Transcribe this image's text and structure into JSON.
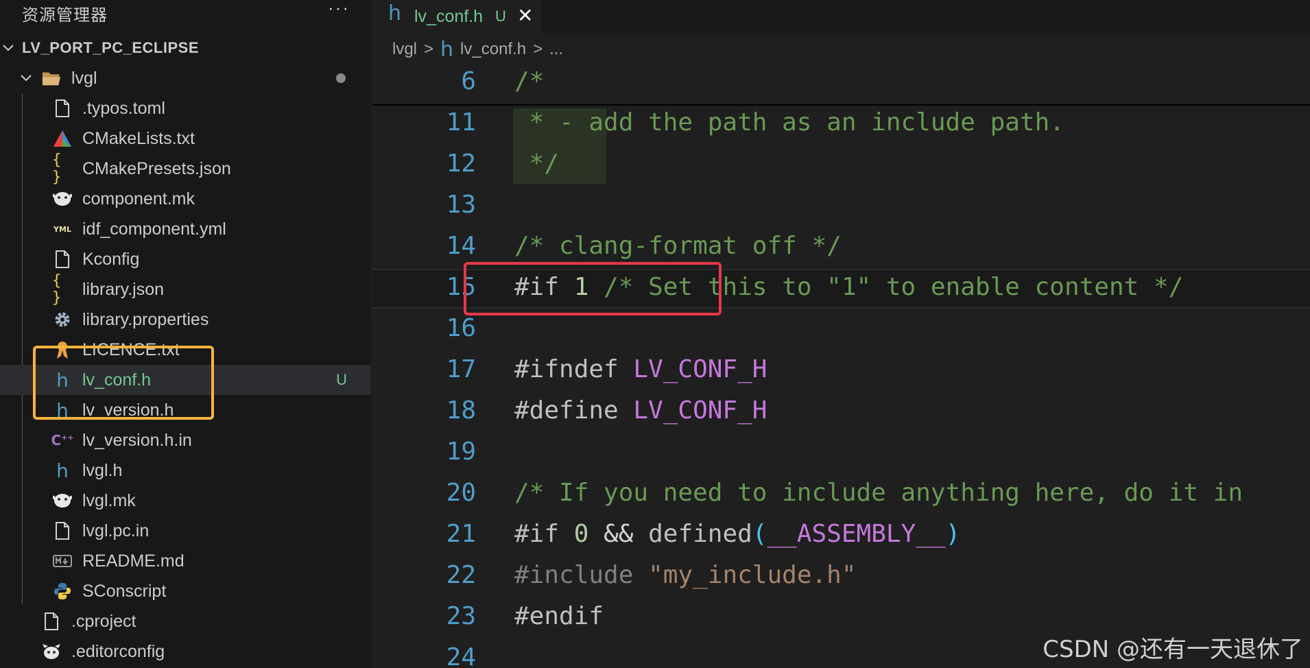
{
  "explorer": {
    "title": "资源管理器",
    "more": "···",
    "project": "LV_PORT_PC_ECLIPSE",
    "folder": "lvgl",
    "files": [
      {
        "name": ".typos.toml",
        "icon": "file-icon"
      },
      {
        "name": "CMakeLists.txt",
        "icon": "cmake-icon"
      },
      {
        "name": "CMakePresets.json",
        "icon": "json-icon"
      },
      {
        "name": "component.mk",
        "icon": "makefile-icon"
      },
      {
        "name": "idf_component.yml",
        "icon": "yaml-icon"
      },
      {
        "name": "Kconfig",
        "icon": "file-icon"
      },
      {
        "name": "library.json",
        "icon": "json-icon"
      },
      {
        "name": "library.properties",
        "icon": "gear-icon"
      },
      {
        "name": "LICENCE.txt",
        "icon": "license-icon"
      },
      {
        "name": "lv_conf.h",
        "icon": "header-h-icon",
        "badge": "U"
      },
      {
        "name": "lv_version.h",
        "icon": "header-h-icon"
      },
      {
        "name": "lv_version.h.in",
        "icon": "cpp-icon"
      },
      {
        "name": "lvgl.h",
        "icon": "header-h-icon"
      },
      {
        "name": "lvgl.mk",
        "icon": "makefile-icon"
      },
      {
        "name": "lvgl.pc.in",
        "icon": "file-icon"
      },
      {
        "name": "README.md",
        "icon": "markdown-icon"
      },
      {
        "name": "SConscript",
        "icon": "python-icon"
      }
    ],
    "root_files": [
      {
        "name": ".cproject",
        "icon": "file-icon"
      },
      {
        "name": ".editorconfig",
        "icon": "editorconfig-icon"
      }
    ]
  },
  "tab": {
    "icon_glyph": "h",
    "label": "lv_conf.h",
    "status": "U",
    "close": "✕"
  },
  "breadcrumb": {
    "folder": "lvgl",
    "sep": ">",
    "icon_glyph": "h",
    "file": "lv_conf.h",
    "more": "..."
  },
  "editor": {
    "lines": [
      {
        "n": "6",
        "text": "/*"
      },
      {
        "n": "11",
        "text": " * - add the path as an include path."
      },
      {
        "n": "12",
        "text": " */"
      },
      {
        "n": "13",
        "text": ""
      },
      {
        "n": "14",
        "text": "/* clang-format off */"
      },
      {
        "n": "15",
        "a": "#if ",
        "b": "1",
        "c": " /* Set this to \"1\" to enable content */"
      },
      {
        "n": "16",
        "text": ""
      },
      {
        "n": "17",
        "a": "#ifndef ",
        "b": "LV_CONF_H"
      },
      {
        "n": "18",
        "a": "#define ",
        "b": "LV_CONF_H"
      },
      {
        "n": "19",
        "text": ""
      },
      {
        "n": "20",
        "text": "/* If you need to include anything here, do it in"
      },
      {
        "n": "21",
        "a": "#if ",
        "b": "0",
        "c": " && ",
        "d": "defined",
        "e": "(",
        "f": "__ASSEMBLY__",
        "g": ")"
      },
      {
        "n": "22",
        "a": "#include ",
        "b": "\"my_include.h\""
      },
      {
        "n": "23",
        "text": "#endif"
      },
      {
        "n": "24",
        "text": ""
      }
    ]
  },
  "watermark": "CSDN @还有一天退休了",
  "colors": {
    "accent_orange": "#f6b53a",
    "accent_red": "#e5394b",
    "git_untracked": "#73c991"
  }
}
